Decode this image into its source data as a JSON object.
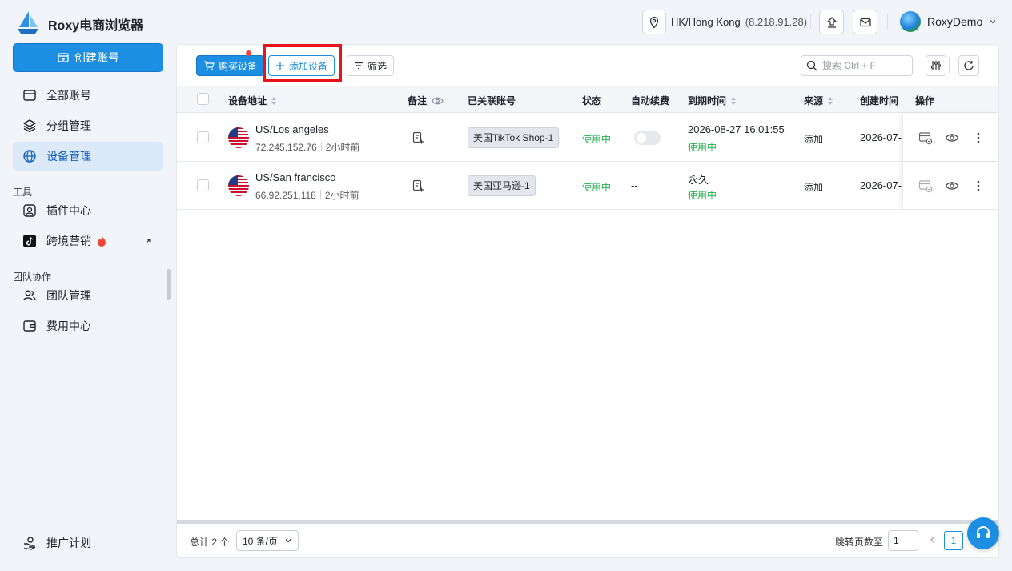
{
  "app": {
    "title": "Roxy电商浏览器"
  },
  "header": {
    "location": "HK/Hong Kong",
    "ip": "(8.218.91.28)",
    "user_name": "RoxyDemo"
  },
  "sidebar": {
    "create_label": "创建账号",
    "items": [
      {
        "label": "全部账号",
        "icon": "window-icon"
      },
      {
        "label": "分组管理",
        "icon": "layers-icon"
      },
      {
        "label": "设备管理",
        "icon": "globe-icon",
        "active": true
      }
    ],
    "tools_section": "工具",
    "tools": [
      {
        "label": "插件中心",
        "icon": "plugin-icon"
      },
      {
        "label": "跨境营销",
        "icon": "tiktok-icon"
      }
    ],
    "team_section": "团队协作",
    "team": [
      {
        "label": "团队管理",
        "icon": "users-icon"
      },
      {
        "label": "费用中心",
        "icon": "wallet-icon"
      }
    ],
    "promo_label": "推广计划"
  },
  "toolbar": {
    "buy_label": "购买设备",
    "add_label": "添加设备",
    "filter_label": "筛选",
    "search_placeholder": "搜索 Ctrl + F"
  },
  "table": {
    "columns": [
      "设备地址",
      "备注",
      "已关联账号",
      "状态",
      "自动续费",
      "到期时间",
      "来源",
      "创建时间",
      "操作"
    ],
    "rows": [
      {
        "location": "US/Los angeles",
        "ip": "72.245.152.76",
        "age": "2小时前",
        "account": "美国TikTok Shop-1",
        "status": "使用中",
        "auto_renew": "off",
        "expire": "2026-08-27 16:01:55",
        "expire_status": "使用中",
        "source": "添加",
        "created": "2026-07-"
      },
      {
        "location": "US/San francisco",
        "ip": "66.92.251.118",
        "age": "2小时前",
        "account": "美国亚马逊-1",
        "status": "使用中",
        "auto_renew": "--",
        "expire": "永久",
        "expire_status": "使用中",
        "source": "添加",
        "created": "2026-07-"
      }
    ]
  },
  "footer": {
    "total": "总计 2 个",
    "page_size": "10 条/页",
    "jump_label": "跳转页数至",
    "jump_value": "1",
    "current_page": "1"
  },
  "colors": {
    "accent": "#1d8fe3",
    "success": "#22b04b",
    "highlight": "#e8141c"
  }
}
